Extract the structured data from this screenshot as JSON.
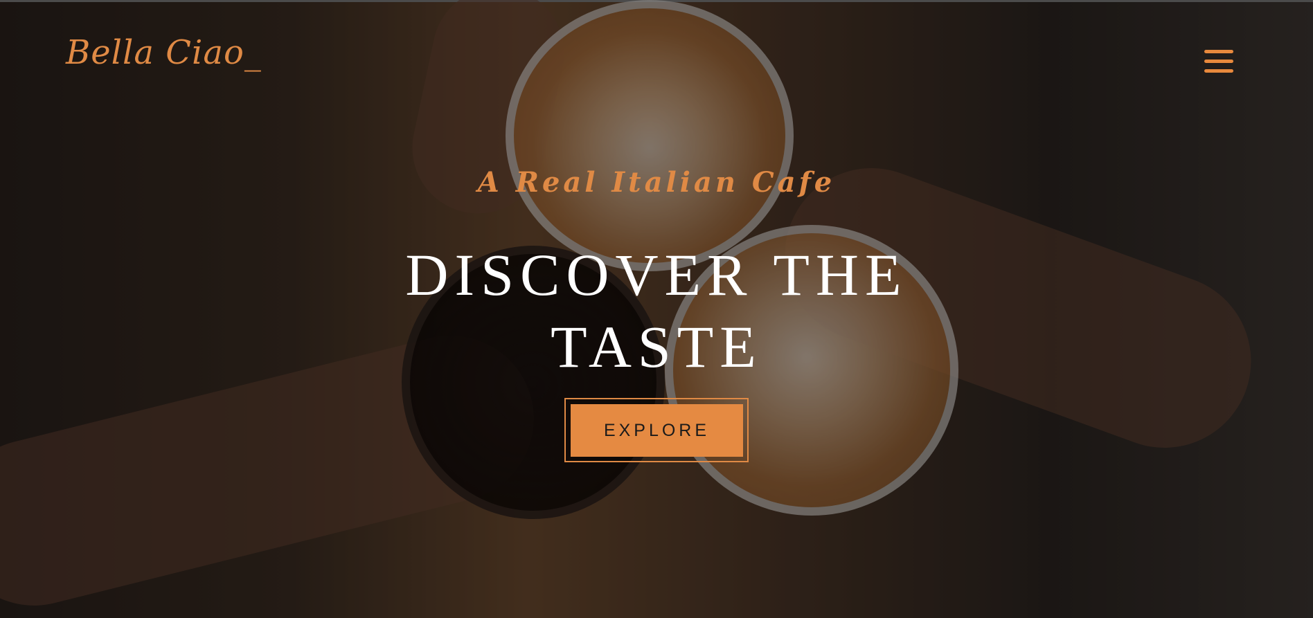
{
  "header": {
    "logo_text": "Bella Ciao_",
    "menu_icon": "hamburger-menu-icon"
  },
  "hero": {
    "tagline": "A Real Italian Cafe",
    "headline": "DISCOVER THE TASTE",
    "cta_label": "EXPLORE"
  },
  "colors": {
    "accent": "#e58a42",
    "headline": "#ffffff"
  }
}
